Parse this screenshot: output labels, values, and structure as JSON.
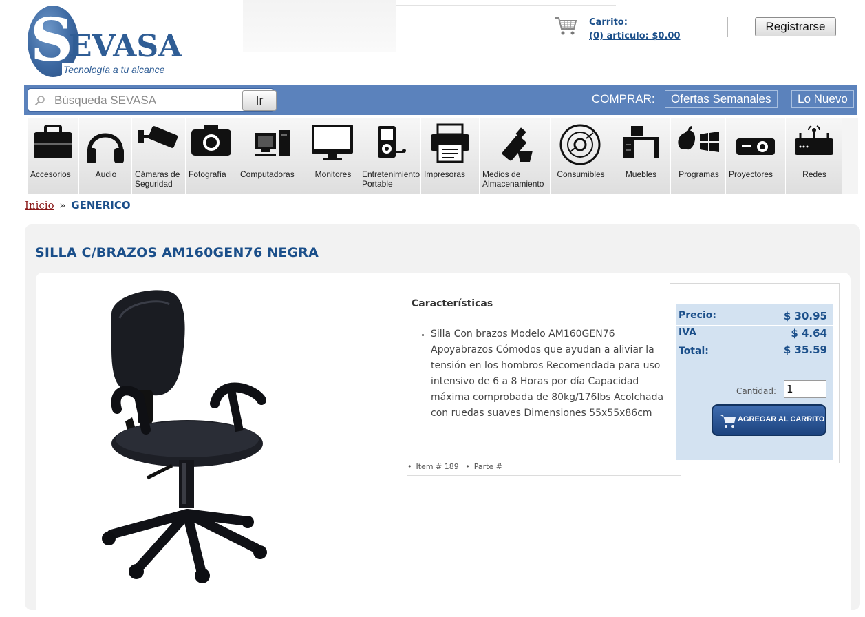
{
  "brand": {
    "name_initial": "S",
    "name_rest": "EVASA",
    "tagline": "Tecnología a tu alcance"
  },
  "cart": {
    "title": "Carrito:",
    "summary": "(0) articulo: $0.00"
  },
  "header": {
    "register_label": "Registrarse"
  },
  "search": {
    "placeholder": "Búsqueda SEVASA",
    "go_label": "Ir"
  },
  "shop_nav": {
    "label": "COMPRAR:",
    "links": [
      "Ofertas Semanales",
      "Lo Nuevo"
    ]
  },
  "categories": [
    {
      "label": "Accesorios",
      "icon": "briefcase-icon"
    },
    {
      "label": "Audio",
      "icon": "headphones-icon"
    },
    {
      "label": "Cámaras de Seguridad",
      "icon": "security-camera-icon"
    },
    {
      "label": "Fotografía",
      "icon": "camera-icon"
    },
    {
      "label": "Computadoras",
      "icon": "desktop-computer-icon"
    },
    {
      "label": "Monitores",
      "icon": "monitor-icon"
    },
    {
      "label": "Entretenimiento Portable",
      "icon": "portable-player-icon"
    },
    {
      "label": "Impresoras",
      "icon": "printer-icon"
    },
    {
      "label": "Medios de Almacenamiento",
      "icon": "usb-drive-icon"
    },
    {
      "label": "Consumibles",
      "icon": "disc-icon"
    },
    {
      "label": "Muebles",
      "icon": "desk-icon"
    },
    {
      "label": "Programas",
      "icon": "software-icon"
    },
    {
      "label": "Proyectores",
      "icon": "projector-icon"
    },
    {
      "label": "Redes",
      "icon": "router-icon"
    }
  ],
  "breadcrumb": {
    "home": "Inicio",
    "separator": "»",
    "current": "GENERICO"
  },
  "product": {
    "title": "SILLA C/BRAZOS AM160GEN76 NEGRA",
    "features_heading": "Características",
    "features": [
      "Silla Con brazos Modelo AM160GEN76 Apoyabrazos Cómodos que ayudan a aliviar la tensión en los hombros Recomendada para uso intensivo de 6 a 8 Horas por día Capacidad máxima comprobada de 80kg/176lbs Acolchada con ruedas suaves Dimensiones 55x55x86cm"
    ],
    "item_label": "Item # 189",
    "part_label": "Parte #",
    "image_alt": "chair-image"
  },
  "pricing": {
    "price_label": "Precio:",
    "price_value": "$ 30.95",
    "tax_label": "IVA",
    "tax_value": "$ 4.64",
    "total_label": "Total:",
    "total_value": "$ 35.59",
    "quantity_label": "Cantidad:",
    "quantity_value": "1",
    "add_to_cart_label": "AGREGAR AL CARRITO"
  },
  "colors": {
    "brand_blue": "#1b4f8a",
    "search_bar": "#5b82bc",
    "price_panel": "#d3e2f1",
    "breadcrumb_link": "#8b1a1a"
  }
}
